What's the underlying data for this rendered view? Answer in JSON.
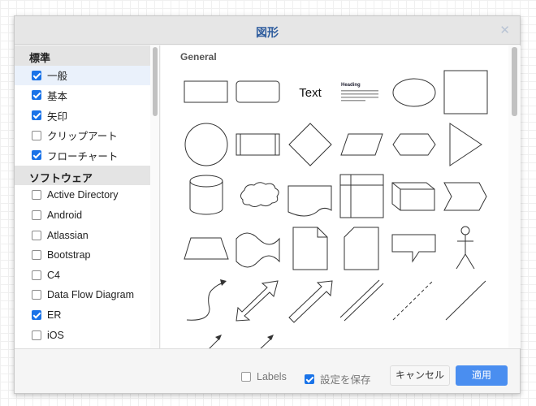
{
  "dialog": {
    "title": "図形",
    "close_icon": "close-icon"
  },
  "sidebar": {
    "sections": [
      {
        "label": "標準",
        "items": [
          {
            "label": "一般",
            "checked": true,
            "selected": true
          },
          {
            "label": "基本",
            "checked": true
          },
          {
            "label": "矢印",
            "checked": true
          },
          {
            "label": "クリップアート",
            "checked": false
          },
          {
            "label": "フローチャート",
            "checked": true
          }
        ]
      },
      {
        "label": "ソフトウェア",
        "items": [
          {
            "label": "Active Directory",
            "checked": false
          },
          {
            "label": "Android",
            "checked": false
          },
          {
            "label": "Atlassian",
            "checked": false
          },
          {
            "label": "Bootstrap",
            "checked": false
          },
          {
            "label": "C4",
            "checked": false
          },
          {
            "label": "Data Flow Diagram",
            "checked": false
          },
          {
            "label": "ER",
            "checked": true
          },
          {
            "label": "iOS",
            "checked": false
          }
        ]
      }
    ]
  },
  "preview": {
    "section_title": "General",
    "text_shape": "Text",
    "textbox_heading": "Heading"
  },
  "footer": {
    "labels_label": "Labels",
    "labels_checked": false,
    "save_label": "設定を保存",
    "save_checked": true,
    "cancel": "キャンセル",
    "apply": "適用"
  },
  "colors": {
    "accent": "#4a8ef0",
    "title": "#2f5d9e"
  }
}
